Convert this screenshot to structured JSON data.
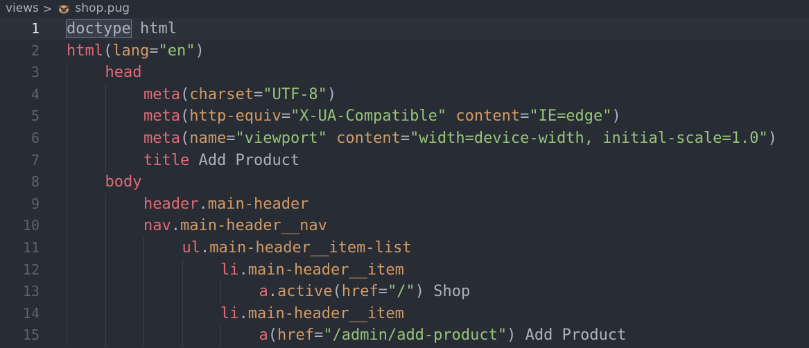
{
  "breadcrumb": {
    "folder": "views",
    "separator": ">",
    "file": "shop.pug"
  },
  "icons": {
    "separator": "chevron-right-icon",
    "file": "pug-file-icon"
  },
  "colors": {
    "background": "#282c34",
    "tag": "#e06c75",
    "attribute": "#d19a66",
    "string": "#98c379",
    "text": "#abb2bf",
    "line_number": "#5c6370"
  },
  "current_line": 1,
  "lines": [
    {
      "n": "1",
      "indent": 0,
      "tokens": [
        [
          "kw",
          "doctype"
        ],
        [
          "pl",
          " html"
        ]
      ]
    },
    {
      "n": "2",
      "indent": 0,
      "tokens": [
        [
          "tag",
          "html"
        ],
        [
          "pl",
          "("
        ],
        [
          "attr",
          "lang"
        ],
        [
          "pl",
          "="
        ],
        [
          "str",
          "\"en\""
        ],
        [
          "pl",
          ")"
        ]
      ]
    },
    {
      "n": "3",
      "indent": 1,
      "tokens": [
        [
          "tag",
          "head"
        ]
      ]
    },
    {
      "n": "4",
      "indent": 2,
      "tokens": [
        [
          "tag",
          "meta"
        ],
        [
          "pl",
          "("
        ],
        [
          "attr",
          "charset"
        ],
        [
          "pl",
          "="
        ],
        [
          "str",
          "\"UTF-8\""
        ],
        [
          "pl",
          ")"
        ]
      ]
    },
    {
      "n": "5",
      "indent": 2,
      "tokens": [
        [
          "tag",
          "meta"
        ],
        [
          "pl",
          "("
        ],
        [
          "attr",
          "http-equiv"
        ],
        [
          "pl",
          "="
        ],
        [
          "str",
          "\"X-UA-Compatible\""
        ],
        [
          "pl",
          " "
        ],
        [
          "attr",
          "content"
        ],
        [
          "pl",
          "="
        ],
        [
          "str",
          "\"IE=edge\""
        ],
        [
          "pl",
          ")"
        ]
      ]
    },
    {
      "n": "6",
      "indent": 2,
      "tokens": [
        [
          "tag",
          "meta"
        ],
        [
          "pl",
          "("
        ],
        [
          "attr",
          "name"
        ],
        [
          "pl",
          "="
        ],
        [
          "str",
          "\"viewport\""
        ],
        [
          "pl",
          " "
        ],
        [
          "attr",
          "content"
        ],
        [
          "pl",
          "="
        ],
        [
          "str",
          "\"width=device-width, initial-scale=1.0\""
        ],
        [
          "pl",
          ")"
        ]
      ]
    },
    {
      "n": "7",
      "indent": 2,
      "tokens": [
        [
          "tag",
          "title"
        ],
        [
          "pl",
          " Add Product"
        ]
      ]
    },
    {
      "n": "8",
      "indent": 1,
      "tokens": [
        [
          "tag",
          "body"
        ]
      ]
    },
    {
      "n": "9",
      "indent": 2,
      "tokens": [
        [
          "tag",
          "header"
        ],
        [
          "pl",
          "."
        ],
        [
          "cls",
          "main-header"
        ]
      ]
    },
    {
      "n": "10",
      "indent": 2,
      "tokens": [
        [
          "tag",
          "nav"
        ],
        [
          "pl",
          "."
        ],
        [
          "cls",
          "main-header__nav"
        ]
      ]
    },
    {
      "n": "11",
      "indent": 3,
      "tokens": [
        [
          "tag",
          "ul"
        ],
        [
          "pl",
          "."
        ],
        [
          "cls",
          "main-header__item-list"
        ]
      ]
    },
    {
      "n": "12",
      "indent": 4,
      "tokens": [
        [
          "tag",
          "li"
        ],
        [
          "pl",
          "."
        ],
        [
          "cls",
          "main-header__item"
        ]
      ]
    },
    {
      "n": "13",
      "indent": 5,
      "tokens": [
        [
          "tag",
          "a"
        ],
        [
          "pl",
          "."
        ],
        [
          "cls",
          "active"
        ],
        [
          "pl",
          "("
        ],
        [
          "attr",
          "href"
        ],
        [
          "pl",
          "="
        ],
        [
          "str",
          "\"/\""
        ],
        [
          "pl",
          ")"
        ],
        [
          "pl",
          " Shop"
        ]
      ]
    },
    {
      "n": "14",
      "indent": 4,
      "tokens": [
        [
          "tag",
          "li"
        ],
        [
          "pl",
          "."
        ],
        [
          "cls",
          "main-header__item"
        ]
      ]
    },
    {
      "n": "15",
      "indent": 5,
      "tokens": [
        [
          "tag",
          "a"
        ],
        [
          "pl",
          "("
        ],
        [
          "attr",
          "href"
        ],
        [
          "pl",
          "="
        ],
        [
          "str",
          "\"/admin/add-product\""
        ],
        [
          "pl",
          ")"
        ],
        [
          "pl",
          " Add Product"
        ]
      ]
    }
  ]
}
